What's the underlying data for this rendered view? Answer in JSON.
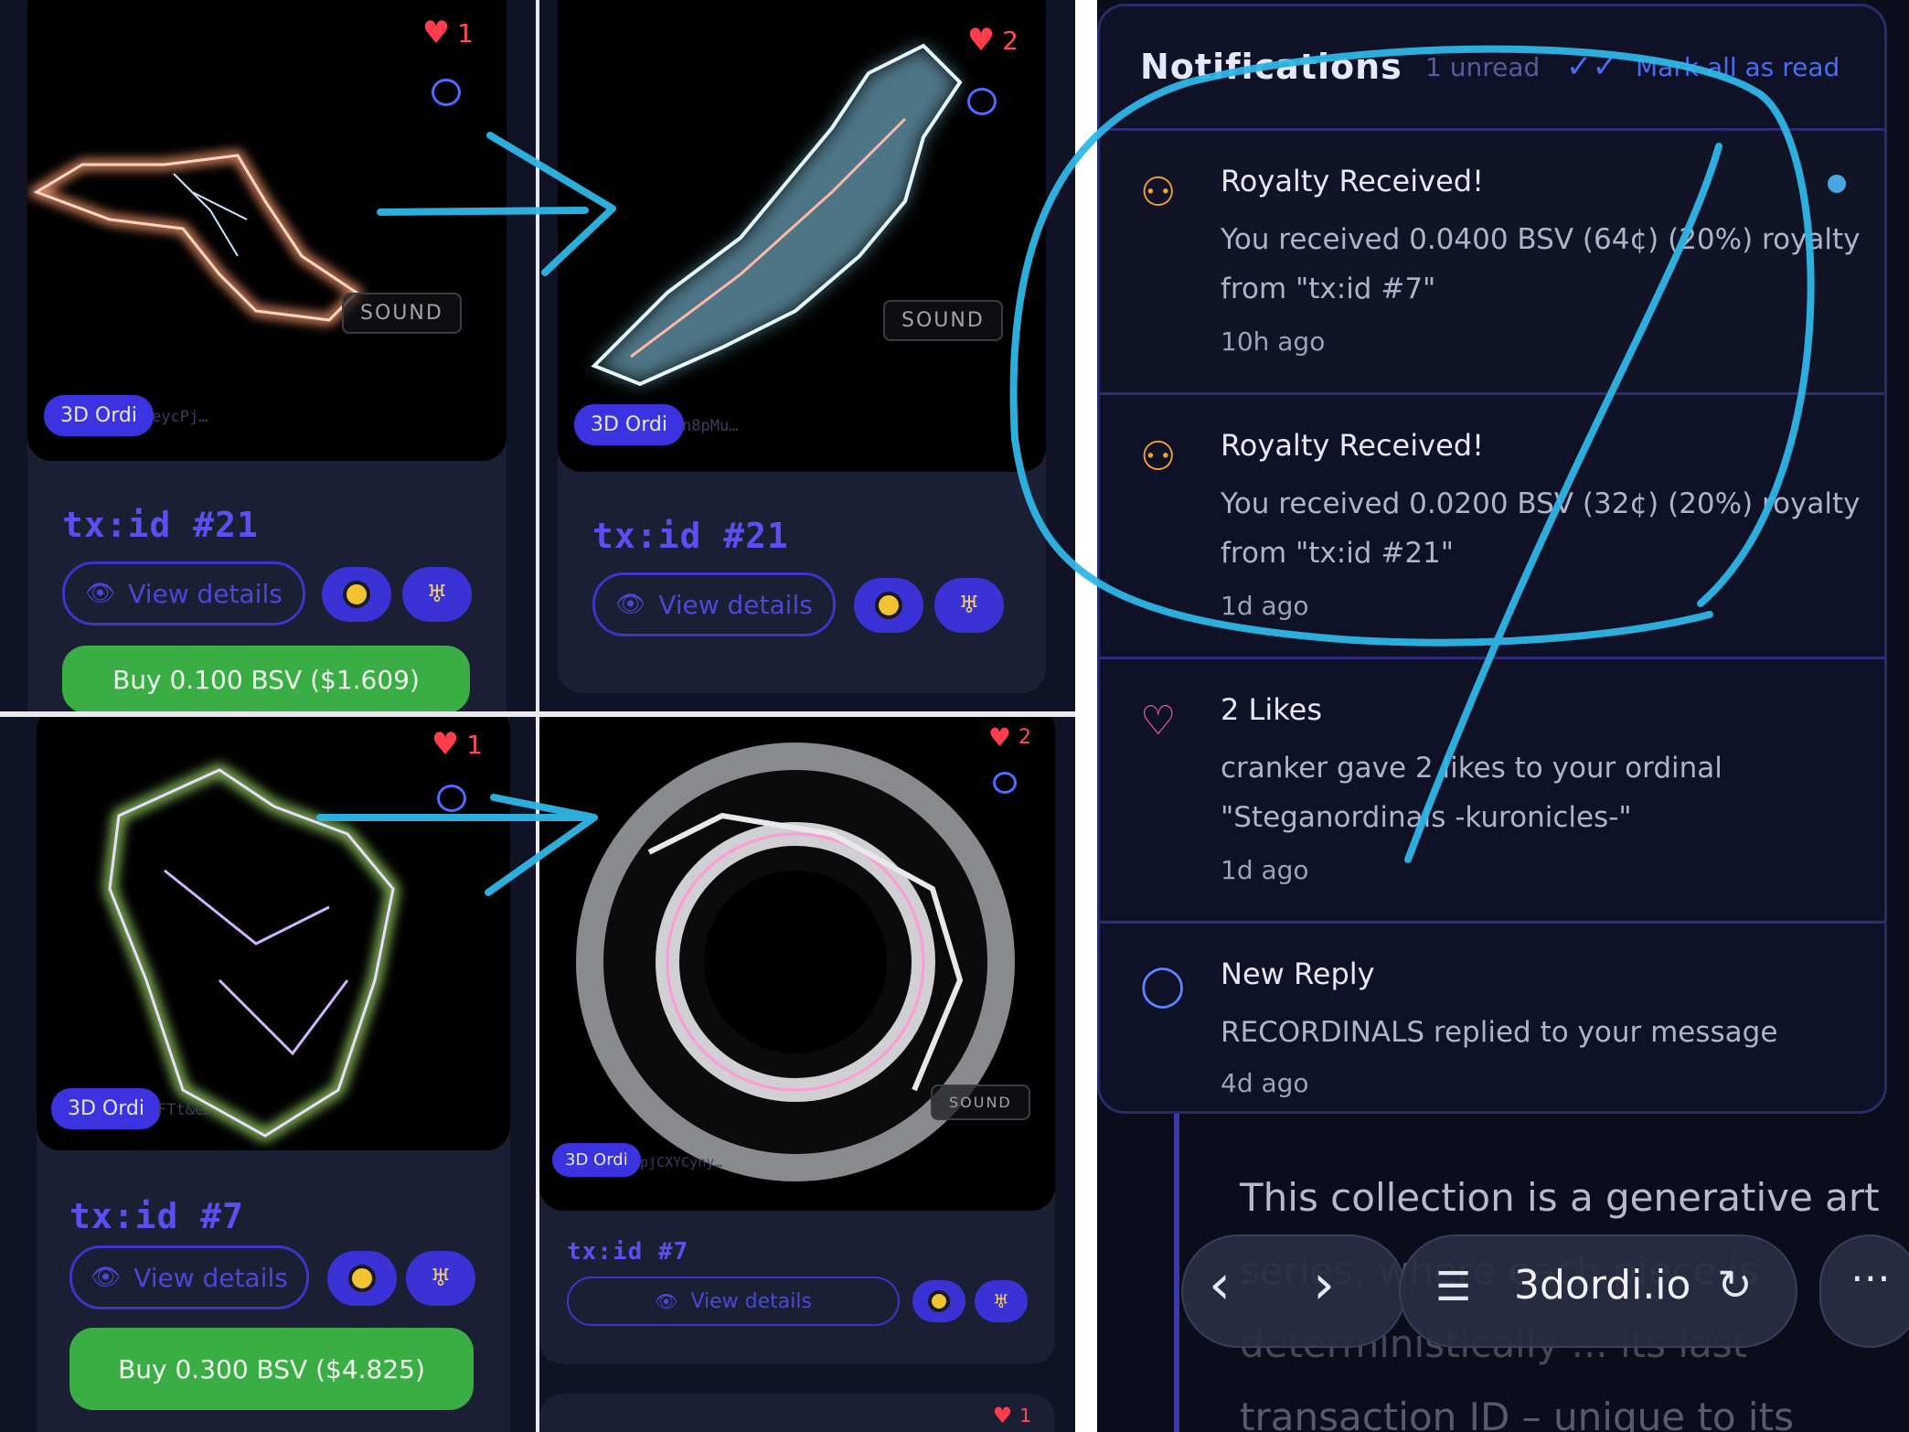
{
  "cards": [
    {
      "likes": "1",
      "sound": "SOUND",
      "badge": "3D Ordi",
      "hash": "eycPj…",
      "title": "tx:id #21",
      "view": "View details",
      "buy": "Buy 0.100 BSV ($1.609)"
    },
    {
      "likes": "2",
      "sound": "SOUND",
      "badge": "3D Ordi",
      "hash": "n8pMu…",
      "title": "tx:id #21",
      "view": "View details"
    },
    {
      "likes": "1",
      "badge": "3D Ordi",
      "hash": "FTt&e…",
      "title": "tx:id #7",
      "view": "View details",
      "buy": "Buy 0.300 BSV ($4.825)"
    },
    {
      "likes": "2",
      "sound": "SOUND",
      "badge": "3D Ordi",
      "hash": "pjCXYCyny…",
      "title": "tx:id #7",
      "view": "View details",
      "likes_peek": "1"
    }
  ],
  "notifications": {
    "title": "Notifications",
    "unread_label": "1 unread",
    "mark_all": "Mark all as read",
    "items": [
      {
        "icon": "royalty-coin-icon",
        "title": "Royalty Received!",
        "line1": "You received 0.0400 BSV (64¢) (20%) royalty",
        "line2": "from \"tx:id #7\"",
        "time": "10h ago",
        "unread": true
      },
      {
        "icon": "royalty-coin-icon",
        "title": "Royalty Received!",
        "line1": "You received 0.0200 BSV (32¢) (20%) royalty",
        "line2": "from \"tx:id #21\"",
        "time": "1d ago"
      },
      {
        "icon": "heart-outline-icon",
        "title": "2 Likes",
        "line1": "cranker gave 2 likes to your ordinal",
        "line2": "\"Steganordinals -kuronicles-\"",
        "time": "1d ago"
      },
      {
        "icon": "reply-bubble-icon",
        "title": "New Reply",
        "line1": "RECORDINALS replied to your message",
        "time": "4d ago"
      }
    ]
  },
  "background": {
    "line1": "This collection is a generative art",
    "line2": "series, where each piece is",
    "line3": "deterministically ... its last",
    "line4": "transaction ID – unique to its"
  },
  "browser": {
    "url": "3dordi.io"
  },
  "colors": {
    "accent": "#3c33e0",
    "buy_green": "#3aad45",
    "annotation": "#2fb6e6",
    "like_red": "#ff3d4d"
  }
}
